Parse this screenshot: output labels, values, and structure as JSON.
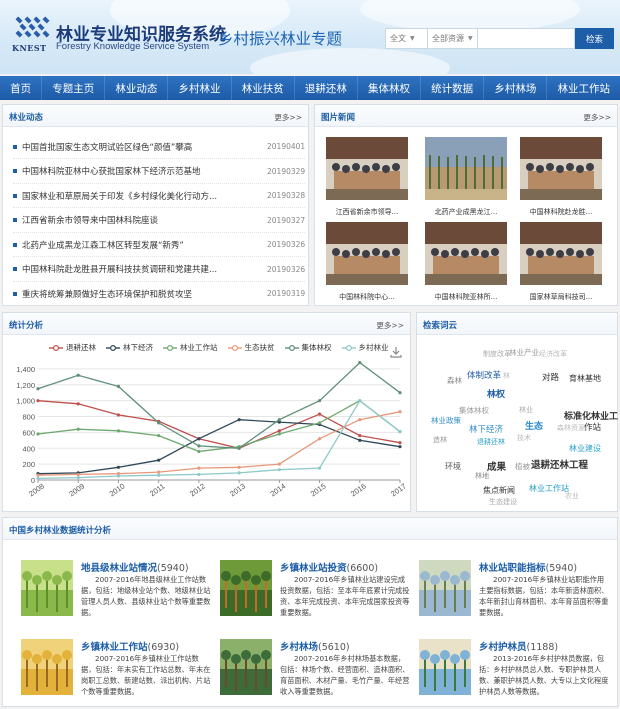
{
  "header": {
    "site_title": "林业专业知识服务系统",
    "site_subtitle": "Forestry Knowledge Service System",
    "logo_text": "KNEST",
    "topic_title": "乡村振兴林业专题",
    "search": {
      "scope": "全文",
      "resource": "全部资源",
      "button": "检索"
    }
  },
  "nav": [
    "首页",
    "专题主页",
    "林业动态",
    "乡村林业",
    "林业扶贫",
    "退耕还林",
    "集体林权",
    "统计数据",
    "乡村林场",
    "林业工作站"
  ],
  "news": {
    "title": "林业动态",
    "more": "更多>>",
    "items": [
      {
        "title": "中国首批国家生态文明试验区绿色“颜值”攀高",
        "date": "20190401"
      },
      {
        "title": "中国林科院亚林中心获批国家林下经济示范基地",
        "date": "20190329"
      },
      {
        "title": "国家林业和草原局关于印发《乡村绿化美化行动方...",
        "date": "20190328"
      },
      {
        "title": "江西省新余市领导来中国林科院座谈",
        "date": "20190327"
      },
      {
        "title": "北药产业成黑龙江森工林区转型发展“新秀”",
        "date": "20190326"
      },
      {
        "title": "中国林科院赴龙胜县开展科技扶贫调研和党建共建...",
        "date": "20190326"
      },
      {
        "title": "重庆将统筹兼顾做好生态环境保护和脱贫攻坚",
        "date": "20190319"
      }
    ]
  },
  "photos": {
    "title": "图片新闻",
    "more": "更多>>",
    "items": [
      {
        "caption": "江西省新余市领导...",
        "theme": "meeting"
      },
      {
        "caption": "北药产业成黑龙江...",
        "theme": "field"
      },
      {
        "caption": "中国林科院赴龙胜...",
        "theme": "meeting"
      },
      {
        "caption": "中国林科院中心...",
        "theme": "meeting"
      },
      {
        "caption": "中国林科院亚林所...",
        "theme": "meeting"
      },
      {
        "caption": "国家林草局科技司...",
        "theme": "meeting"
      }
    ]
  },
  "stats_panel": {
    "title": "统计分析",
    "more": "更多>>"
  },
  "chart_data": {
    "type": "line",
    "categories": [
      "2008",
      "2009",
      "2010",
      "2011",
      "2012",
      "2013",
      "2014",
      "2015",
      "2016",
      "2017"
    ],
    "ylim": [
      0,
      1500
    ],
    "yticks": [
      "0",
      "200",
      "400",
      "600",
      "800",
      "1,000",
      "1,200",
      "1,400"
    ],
    "grid": true,
    "legend_position": "top",
    "series": [
      {
        "name": "退耕还林",
        "color": "#c0504d",
        "values": [
          1000,
          960,
          820,
          740,
          520,
          400,
          620,
          830,
          560,
          470
        ]
      },
      {
        "name": "林下经济",
        "color": "#2f4858",
        "values": [
          80,
          90,
          160,
          250,
          520,
          760,
          730,
          700,
          500,
          420
        ]
      },
      {
        "name": "林业工作站",
        "color": "#6fa96f",
        "values": [
          580,
          640,
          620,
          560,
          360,
          420,
          580,
          720,
          1000,
          610
        ]
      },
      {
        "name": "生态扶贫",
        "color": "#e8987a",
        "values": [
          60,
          70,
          80,
          100,
          150,
          160,
          200,
          520,
          760,
          860
        ]
      },
      {
        "name": "集体林权",
        "color": "#5f8f79",
        "values": [
          1150,
          1320,
          1180,
          720,
          430,
          400,
          760,
          1000,
          1480,
          1100
        ]
      },
      {
        "name": "乡村林业",
        "color": "#8fc9c9",
        "values": [
          20,
          30,
          50,
          60,
          70,
          90,
          130,
          150,
          1000,
          610
        ]
      }
    ]
  },
  "tagcloud": {
    "title": "检索词云",
    "tags": [
      {
        "text": "制度改革",
        "color": "#aaa"
      },
      {
        "text": "林业产业",
        "color": "#999"
      },
      {
        "text": "经济改革",
        "color": "#bbb"
      },
      {
        "text": "森林",
        "color": "#888"
      },
      {
        "text": "体制改革",
        "color": "#1f5ea6"
      },
      {
        "text": "林",
        "color": "#bbb"
      },
      {
        "text": "林权",
        "color": "#1f5ea6"
      },
      {
        "text": "对路",
        "color": "#333"
      },
      {
        "text": "育林基地",
        "color": "#333"
      },
      {
        "text": "集体林权",
        "color": "#999"
      },
      {
        "text": "林业",
        "color": "#aaa"
      },
      {
        "text": "林业政策",
        "color": "#2e8bc6"
      },
      {
        "text": "林下经济",
        "color": "#2e8bc6"
      },
      {
        "text": "生态",
        "color": "#2e8bc6"
      },
      {
        "text": "标准化林业工",
        "color": "#333"
      },
      {
        "text": "作站",
        "color": "#333"
      },
      {
        "text": "森林资源",
        "color": "#bbb"
      },
      {
        "text": "造林",
        "color": "#999"
      },
      {
        "text": "退耕还林",
        "color": "#2ca0c8"
      },
      {
        "text": "环境",
        "color": "#555"
      },
      {
        "text": "成果",
        "color": "#333"
      },
      {
        "text": "林业建设",
        "color": "#2ca0c8"
      },
      {
        "text": "植被",
        "color": "#999"
      },
      {
        "text": "退耕还林工程",
        "color": "#333"
      },
      {
        "text": "林地",
        "color": "#888"
      },
      {
        "text": "焦点新闻",
        "color": "#333"
      },
      {
        "text": "林业工作站",
        "color": "#2ca0c8"
      },
      {
        "text": "技术",
        "color": "#bbb"
      },
      {
        "text": "生态建设",
        "color": "#aaa"
      },
      {
        "text": "农业",
        "color": "#bbb"
      }
    ]
  },
  "stats_section": {
    "title": "中国乡村林业数据统计分析",
    "items": [
      {
        "title": "地县级林业站情况",
        "count": "(5940)",
        "desc": "2007-2016年地县级林业工作站数据，包括：地级林业站个数、地级林业站管理人员人数、县级林业站个数等重要数据。",
        "theme": "green"
      },
      {
        "title": "乡镇林业站投资",
        "count": "(6600)",
        "desc": "2007-2016年乡镇林业站建设完成投资数据，包括：至本年年底累计完成投资、本年完成投资、本年完成国家投资等重要数据。",
        "theme": "fruit"
      },
      {
        "title": "林业站职能指标",
        "count": "(5940)",
        "desc": "2007-2016年乡镇林业站职能作用主要指标数据，包括：本年新造林面积、本年新封山育林面积、本年育苗面积等重要数据。",
        "theme": "trees"
      },
      {
        "title": "乡镇林业工作站",
        "count": "(6930)",
        "desc": "2007-2016年乡镇林业工作站数据，包括：年末实有工作站总数、年末在岗职工总数、新建站数、派出机构、片站个数等重要数据。",
        "theme": "autumn"
      },
      {
        "title": "乡村林场",
        "count": "(5610)",
        "desc": "2007-2016年乡村林场基本数据，包括：林场个数、经营面积、造林面积、育苗面积、木材产量、毛竹产量、年经营收入等重要数据。",
        "theme": "forest"
      },
      {
        "title": "乡村护林员",
        "count": "(1188)",
        "desc": "2013-2016年乡村护林员数据，包括：乡村护林员总人数、专职护林员人数、兼职护林员人数、大专以上文化程度护林员人数等数据。",
        "theme": "lake"
      }
    ]
  }
}
